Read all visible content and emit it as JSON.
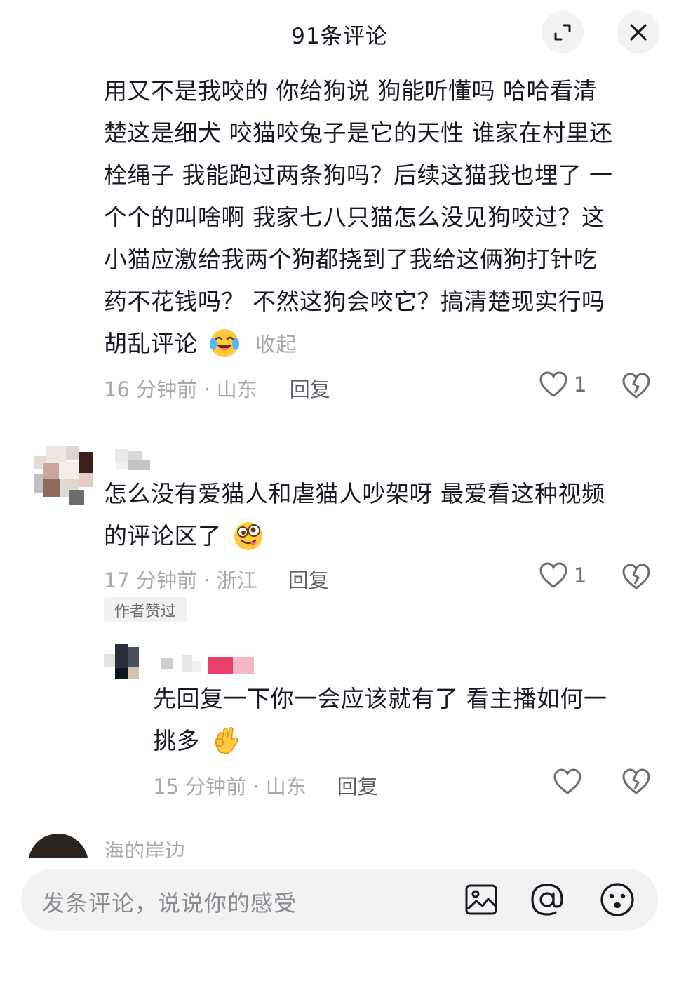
{
  "header": {
    "title": "91条评论"
  },
  "comments": [
    {
      "lines": [
        "用又不是我咬的 你给狗说 狗能听懂吗 哈哈看清",
        "楚这是细犬 咬猫咬兔子是它的天性 谁家在村里还",
        "栓绳子 我能跑过两条狗吗？后续这猫我也埋了 一",
        "个个的叫啥啊 我家七八只猫怎么没见狗咬过？这",
        "小猫应激给我两个狗都挠到了我给这俩狗打针吃",
        "药不花钱吗？ 不然这狗会咬它？搞清楚现实行吗",
        "胡乱评论"
      ],
      "emoji": "laughing-crying-emoji",
      "collapse_label": "收起",
      "time": "16 分钟前 · 山东",
      "reply_label": "回复",
      "likes": "1"
    },
    {
      "lines": [
        "怎么没有爱猫人和虐猫人吵架呀 最爱看这种视频",
        "的评论区了"
      ],
      "emoji": "silly-face-emoji",
      "time": "17 分钟前 · 浙江",
      "reply_label": "回复",
      "likes": "1",
      "badge": "作者赞过"
    },
    {
      "lines": [
        "先回复一下你一会应该就有了 看主播如何一",
        "挑多"
      ],
      "emoji": "ok-hand-emoji",
      "time": "15 分钟前 · 山东",
      "reply_label": "回复"
    },
    {
      "username": "海的岸边"
    }
  ],
  "input": {
    "placeholder": "发条评论，说说你的感受"
  },
  "colors": {
    "text": "#161823",
    "muted": "#a8a9ad",
    "bar": "#f2f2f3"
  }
}
